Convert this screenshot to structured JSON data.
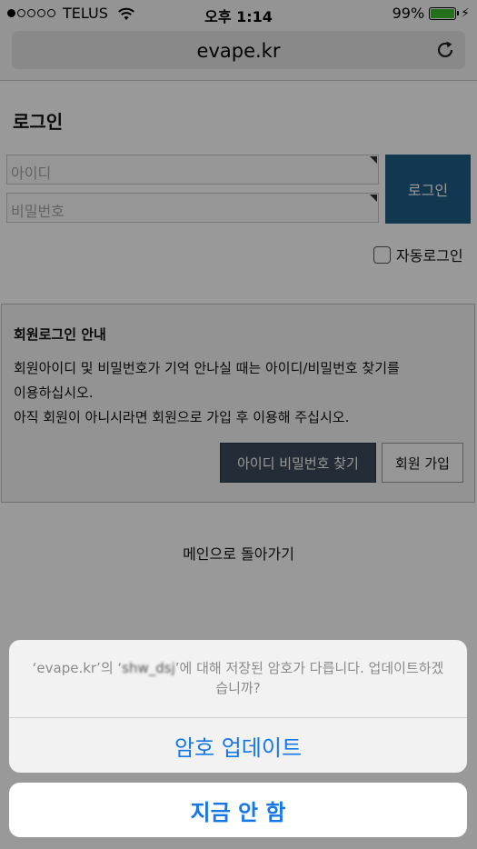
{
  "status_bar": {
    "carrier": "TELUS",
    "time": "오후 1:14",
    "battery": "99%",
    "battery_level": 0.99,
    "signal_bars_filled": 1,
    "signal_bars_total": 5
  },
  "browser": {
    "url": "evape.kr",
    "reload_icon": "reload-icon"
  },
  "page": {
    "title": "로그인",
    "id_placeholder": "아이디",
    "password_placeholder": "비밀번호",
    "login_button": "로그인",
    "auto_login_label": "자동로그인",
    "info": {
      "title": "회원로그인 안내",
      "line1": "회원아이디 및 비밀번호가 기억 안나실 때는 아이디/비밀번호 찾기를",
      "line2": "이용하십시오.",
      "line3": "아직 회원이 아니시라면 회원으로 가입 후 이용해 주십시오.",
      "find_button": "아이디 비밀번호 찾기",
      "join_button": "회원 가입"
    },
    "back_link": "메인으로 돌아가기"
  },
  "action_sheet": {
    "message_prefix": "‘evape.kr’의 ‘",
    "message_account": "shw_dsj",
    "message_suffix": "’에 대해 저장된 암호가 다릅니다. 업데이트하겠습니까?",
    "update_button": "암호 업데이트",
    "cancel_button": "지금 안 함"
  },
  "colors": {
    "link_blue": "#1677e8",
    "login_button_bg": "#1e5c86",
    "find_button_bg": "#3d4b5c",
    "battery_green": "#3dbb2f"
  }
}
